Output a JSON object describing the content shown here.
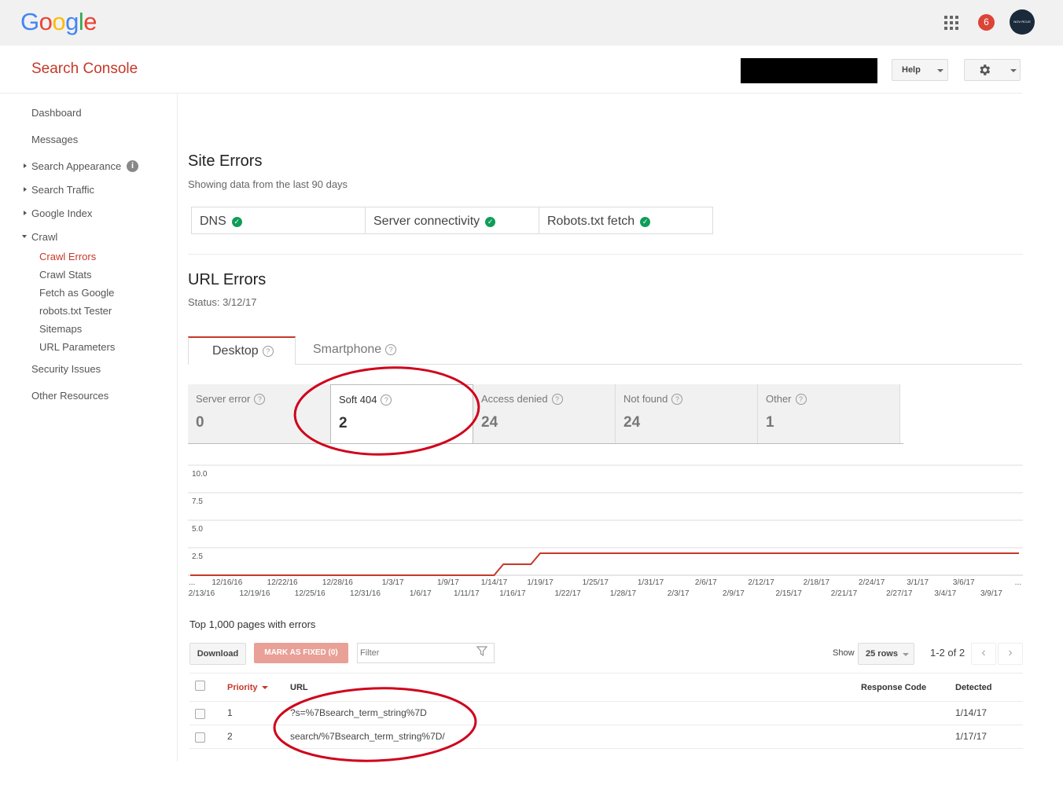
{
  "topbar": {
    "logo": "Google",
    "notifications": "6",
    "avatar_text": "NOV·RCUS"
  },
  "header": {
    "app_title": "Search Console",
    "help_label": "Help"
  },
  "sidebar": {
    "items": [
      {
        "label": "Dashboard"
      },
      {
        "label": "Messages"
      },
      {
        "label": "Search Appearance"
      },
      {
        "label": "Search Traffic"
      },
      {
        "label": "Google Index"
      },
      {
        "label": "Crawl"
      },
      {
        "label": "Security Issues"
      },
      {
        "label": "Other Resources"
      }
    ],
    "crawl_children": [
      {
        "label": "Crawl Errors"
      },
      {
        "label": "Crawl Stats"
      },
      {
        "label": "Fetch as Google"
      },
      {
        "label": "robots.txt Tester"
      },
      {
        "label": "Sitemaps"
      },
      {
        "label": "URL Parameters"
      }
    ]
  },
  "site_errors": {
    "title": "Site Errors",
    "subtitle": "Showing data from the last 90 days",
    "checks": [
      {
        "label": "DNS"
      },
      {
        "label": "Server connectivity"
      },
      {
        "label": "Robots.txt fetch"
      }
    ]
  },
  "url_errors": {
    "title": "URL Errors",
    "status": "Status: 3/12/17",
    "tabs": [
      {
        "label": "Desktop"
      },
      {
        "label": "Smartphone"
      }
    ],
    "stats": [
      {
        "label": "Server error",
        "value": "0"
      },
      {
        "label": "Soft 404",
        "value": "2"
      },
      {
        "label": "Access denied",
        "value": "24"
      },
      {
        "label": "Not found",
        "value": "24"
      },
      {
        "label": "Other",
        "value": "1"
      }
    ]
  },
  "chart_data": {
    "type": "line",
    "y_ticks": [
      "10.0",
      "7.5",
      "5.0",
      "2.5"
    ],
    "ylim": [
      0,
      10
    ],
    "x_labels_top": [
      "12/16/16",
      "12/22/16",
      "12/28/16",
      "1/3/17",
      "1/9/17",
      "1/14/17",
      "1/19/17",
      "1/25/17",
      "1/31/17",
      "2/6/17",
      "2/12/17",
      "2/18/17",
      "2/24/17",
      "3/1/17",
      "3/6/17"
    ],
    "x_labels_bottom": [
      "12/13/16",
      "12/19/16",
      "12/25/16",
      "12/31/16",
      "1/6/17",
      "1/11/17",
      "1/16/17",
      "1/22/17",
      "1/28/17",
      "2/3/17",
      "2/9/17",
      "2/15/17",
      "2/21/17",
      "2/27/17",
      "3/4/17",
      "3/9/17"
    ],
    "x_ellipsis": "...",
    "series": [
      {
        "color": "#c53929",
        "points": [
          [
            "12/12/16",
            0
          ],
          [
            "1/14/17",
            0
          ],
          [
            "1/15/17",
            1
          ],
          [
            "1/18/17",
            1
          ],
          [
            "1/19/17",
            2
          ],
          [
            "3/12/17",
            2
          ]
        ]
      }
    ],
    "grid": true
  },
  "table": {
    "title": "Top 1,000 pages with errors",
    "download_label": "Download",
    "mark_fixed_label": "MARK AS FIXED (0)",
    "filter_placeholder": "Filter",
    "show_label": "Show",
    "rows_label": "25 rows",
    "pager_text": "1-2 of 2",
    "headers": {
      "priority": "Priority",
      "url": "URL",
      "response_code": "Response Code",
      "detected": "Detected"
    },
    "rows": [
      {
        "priority": "1",
        "url": "?s=%7Bsearch_term_string%7D",
        "response_code": "",
        "detected": "1/14/17"
      },
      {
        "priority": "2",
        "url": "search/%7Bsearch_term_string%7D/",
        "response_code": "",
        "detected": "1/17/17"
      }
    ]
  },
  "colors": {
    "accent": "#c53929",
    "ok": "#0f9d58",
    "annotation": "#d0021b"
  }
}
